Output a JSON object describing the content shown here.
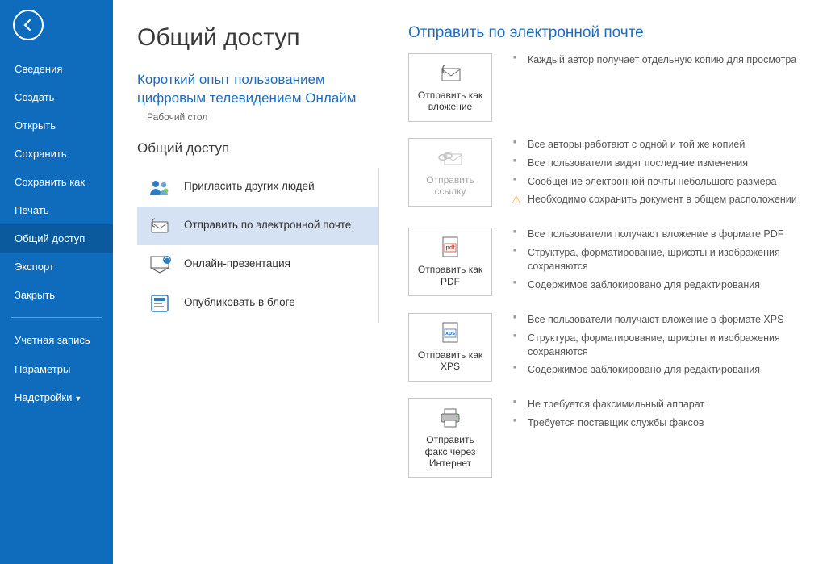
{
  "sidebar": {
    "items": [
      {
        "label": "Сведения"
      },
      {
        "label": "Создать"
      },
      {
        "label": "Открыть"
      },
      {
        "label": "Сохранить"
      },
      {
        "label": "Сохранить как"
      },
      {
        "label": "Печать"
      },
      {
        "label": "Общий доступ"
      },
      {
        "label": "Экспорт"
      },
      {
        "label": "Закрыть"
      }
    ],
    "footer": [
      {
        "label": "Учетная запись"
      },
      {
        "label": "Параметры"
      },
      {
        "label": "Надстройки"
      }
    ]
  },
  "page_title": "Общий доступ",
  "doc": {
    "title": "Короткий опыт пользованием цифровым телевидением Онлайм",
    "path": "Рабочий стол"
  },
  "share_section_title": "Общий доступ",
  "share_options": [
    {
      "label": "Пригласить других людей"
    },
    {
      "label": "Отправить по электронной почте"
    },
    {
      "label": "Онлайн-презентация"
    },
    {
      "label": "Опубликовать в блоге"
    }
  ],
  "email_section_title": "Отправить по электронной почте",
  "email_options": [
    {
      "label": "Отправить как вложение",
      "bullets": [
        "Каждый автор получает отдельную копию для просмотра"
      ]
    },
    {
      "label": "Отправить ссылку",
      "disabled": true,
      "bullets": [
        "Все авторы работают с одной и той же копией",
        "Все пользователи видят последние изменения",
        "Сообщение электронной почты небольшого размера"
      ],
      "warning": "Необходимо сохранить документ в общем расположении"
    },
    {
      "label": "Отправить как PDF",
      "bullets": [
        "Все пользователи получают вложение в формате PDF",
        "Структура, форматирование, шрифты и изображения сохраняются",
        "Содержимое заблокировано для редактирования"
      ]
    },
    {
      "label": "Отправить как XPS",
      "bullets": [
        "Все пользователи получают вложение в формате XPS",
        "Структура, форматирование, шрифты и изображения сохраняются",
        "Содержимое заблокировано для редактирования"
      ]
    },
    {
      "label": "Отправить факс через Интернет",
      "bullets": [
        "Не требуется факсимильный аппарат",
        "Требуется поставщик службы факсов"
      ]
    }
  ]
}
